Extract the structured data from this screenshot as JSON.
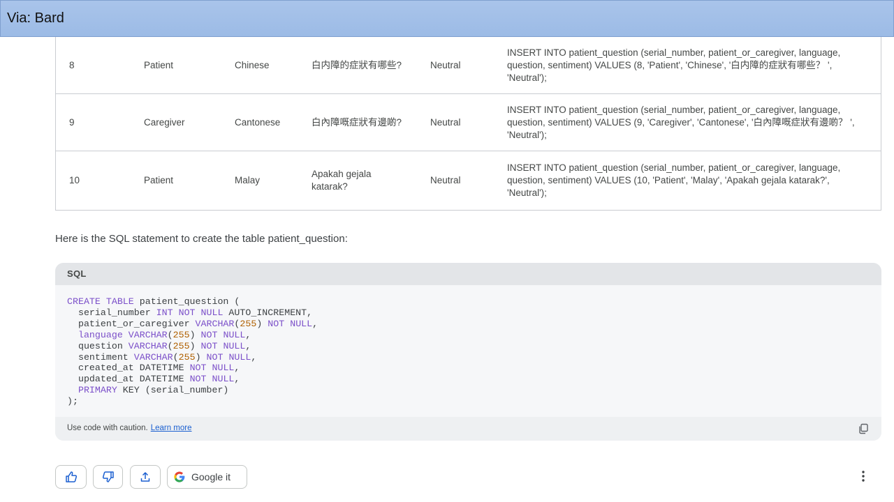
{
  "banner": {
    "title": "Via: Bard"
  },
  "table": {
    "rows": [
      {
        "num": "8",
        "role": "Patient",
        "language": "Chinese",
        "question": "白内障的症狀有哪些?",
        "sentiment": "Neutral",
        "sql": "INSERT INTO patient_question (serial_number, patient_or_caregiver, language, question, sentiment) VALUES (8, 'Patient', 'Chinese', '白内障的症狀有哪些？ ', 'Neutral');"
      },
      {
        "num": "9",
        "role": "Caregiver",
        "language": "Cantonese",
        "question": "白內障嘅症狀有邊啲?",
        "sentiment": "Neutral",
        "sql": "INSERT INTO patient_question (serial_number, patient_or_caregiver, language, question, sentiment) VALUES (9, 'Caregiver', 'Cantonese', '白內障嘅症狀有邊啲？ ', 'Neutral');"
      },
      {
        "num": "10",
        "role": "Patient",
        "language": "Malay",
        "question": "Apakah gejala katarak?",
        "sentiment": "Neutral",
        "sql": "INSERT INTO patient_question (serial_number, patient_or_caregiver, language, question, sentiment) VALUES (10, 'Patient', 'Malay', 'Apakah gejala katarak?', 'Neutral');"
      }
    ]
  },
  "intro": "Here is the SQL statement to create the table patient_question:",
  "code": {
    "language": "SQL",
    "lines": {
      "l1_kw": "CREATE TABLE",
      "l1_rest": " patient_question (",
      "l2_name": "  serial_number ",
      "l2_kw": "INT NOT NULL",
      "l2_rest": " AUTO_INCREMENT,",
      "l3_name": "  patient_or_caregiver ",
      "l3_kw": "VARCHAR",
      "l3_p1": "(",
      "l3_num": "255",
      "l3_p2": ") ",
      "l3_kw2": "NOT NULL",
      "l3_end": ",",
      "l4_name": "  language ",
      "l4_kw": "VARCHAR",
      "l4_p1": "(",
      "l4_num": "255",
      "l4_p2": ") ",
      "l4_kw2": "NOT NULL",
      "l4_end": ",",
      "l5_name": "  question ",
      "l5_kw": "VARCHAR",
      "l5_p1": "(",
      "l5_num": "255",
      "l5_p2": ") ",
      "l5_kw2": "NOT NULL",
      "l5_end": ",",
      "l6_name": "  sentiment ",
      "l6_kw": "VARCHAR",
      "l6_p1": "(",
      "l6_num": "255",
      "l6_p2": ") ",
      "l6_kw2": "NOT NULL",
      "l6_end": ",",
      "l7_name": "  created_at DATETIME ",
      "l7_kw": "NOT NULL",
      "l7_end": ",",
      "l8_name": "  updated_at DATETIME ",
      "l8_kw": "NOT NULL",
      "l8_end": ",",
      "l9_kw": "  PRIMARY",
      "l9_rest": " KEY (serial_number)",
      "l10": ");"
    },
    "footer_text": "Use code with caution.",
    "footer_link": "Learn more"
  },
  "actions": {
    "google_label": "Google it"
  },
  "colors": {
    "keyword": "#7b4fc9",
    "number": "#b06000",
    "link": "#1a5fd0"
  },
  "icons": [
    "thumbs-up-icon",
    "thumbs-down-icon",
    "share-icon",
    "google-g-icon",
    "copy-icon",
    "more-vert-icon"
  ]
}
